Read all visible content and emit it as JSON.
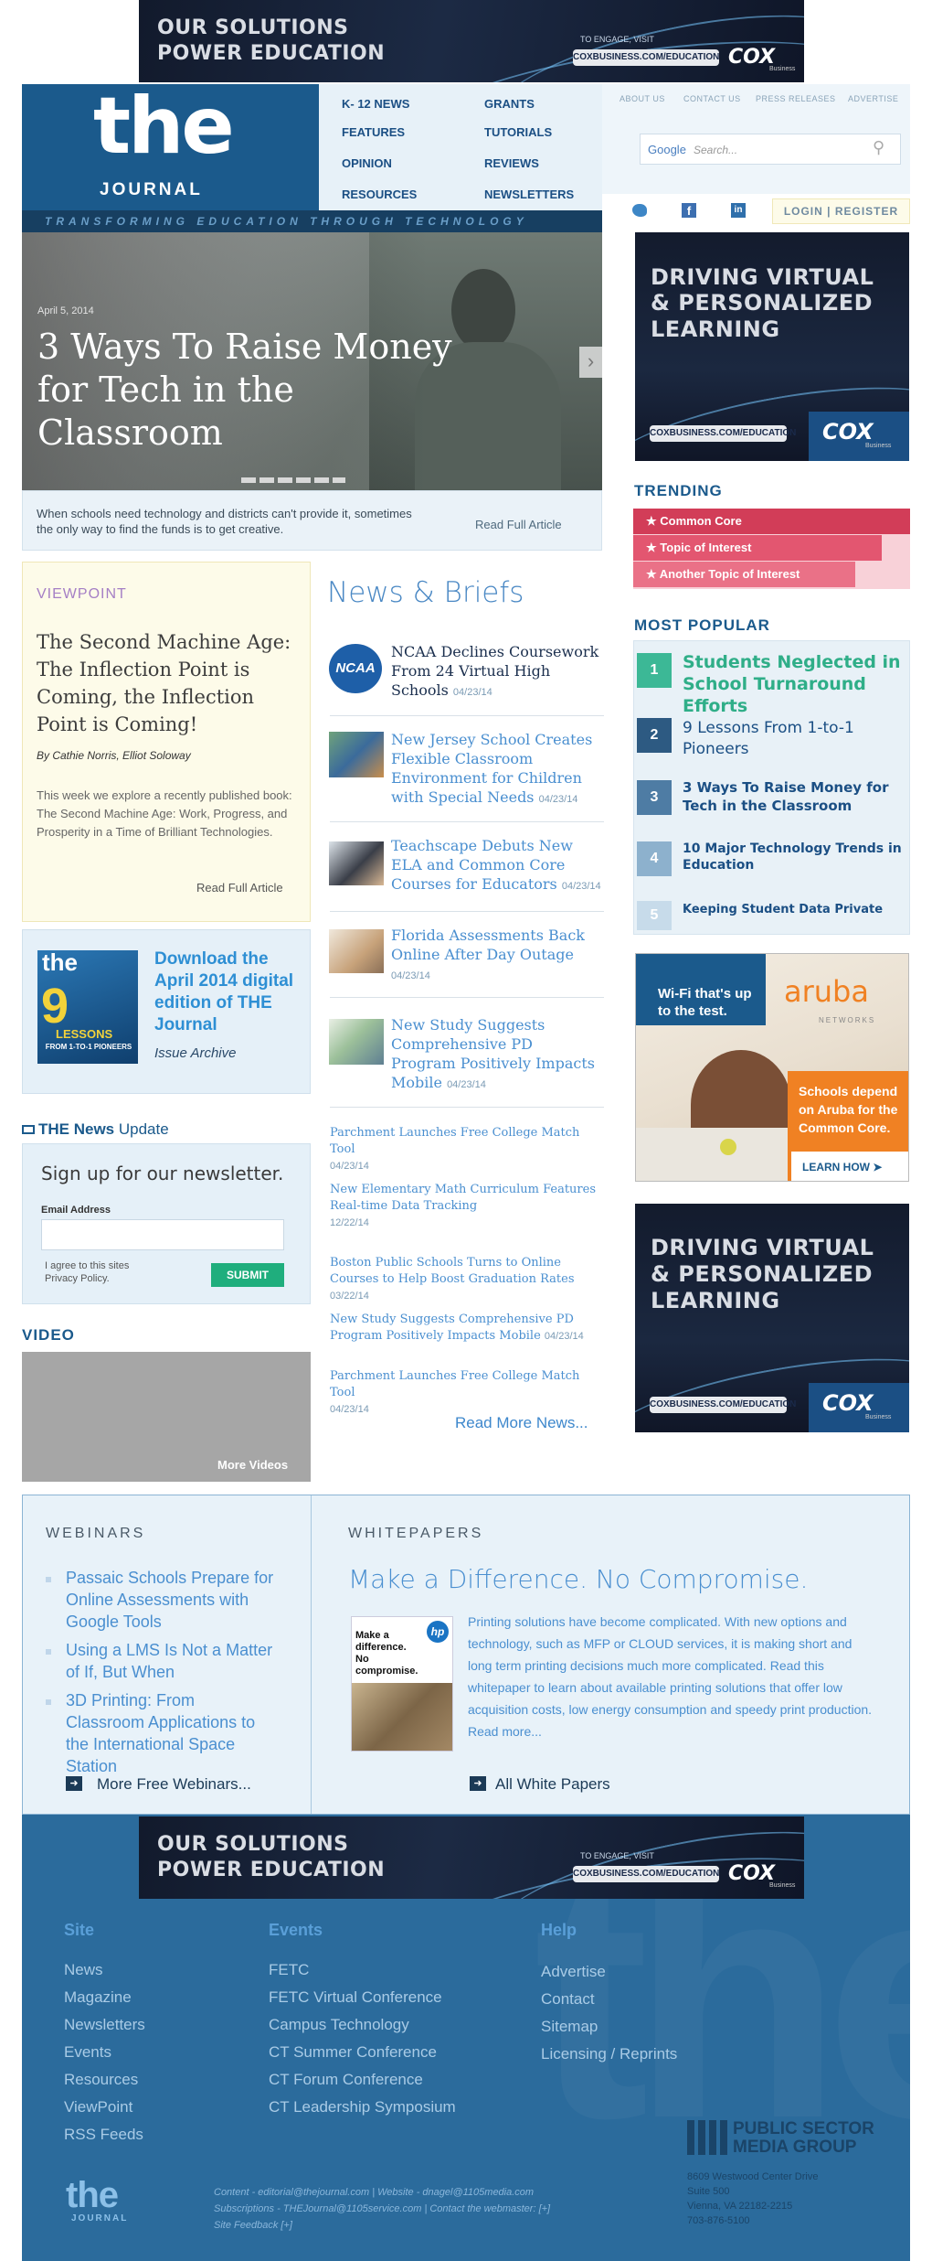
{
  "ad_top": {
    "line1": "OUR SOLUTIONS",
    "line2": "POWER EDUCATION",
    "visit": "TO ENGAGE, VISIT",
    "url": "COXBUSINESS.COM/EDUCATION",
    "brand": "COX",
    "brand_sub": "Business"
  },
  "header": {
    "logo_the": "the",
    "logo_journal": "JOURNAL",
    "tagline": "TRANSFORMING EDUCATION THROUGH TECHNOLOGY",
    "nav": [
      "K- 12 NEWS",
      "GRANTS",
      "FEATURES",
      "TUTORIALS",
      "OPINION",
      "REVIEWS",
      "RESOURCES",
      "NEWSLETTERS"
    ],
    "util": [
      "ABOUT US",
      "CONTACT US",
      "PRESS RELEASES",
      "ADVERTISE"
    ],
    "search_brand": "Google",
    "search_placeholder": "Search...",
    "login": "LOGIN | REGISTER"
  },
  "hero": {
    "date": "April 5, 2014",
    "title": "3 Ways To Raise Money for Tech in the Classroom",
    "caption": "When schools need technology and districts can't provide it, sometimes the only way to find the funds is to get creative.",
    "read_more": "Read Full Article"
  },
  "viewpoint": {
    "label": "VIEWPOINT",
    "title": "The Second Machine Age: The Inflection Point is Coming, the Inflection Point is Coming!",
    "authors": "By Cathie Norris, Elliot Soloway",
    "body": "This week we explore a recently published book: The Second Machine Age: Work, Progress, and Prosperity in a Time of Brilliant Technologies.",
    "read_more": "Read Full Article"
  },
  "digital": {
    "cover_the": "the",
    "cover_num": "9",
    "cover_lessons": "LESSONS",
    "cover_sub": "FROM 1-TO-1 PIONEERS",
    "title": "Download the April 2014 digital edition of THE Journal",
    "archive": "Issue Archive"
  },
  "newsletter": {
    "heading_bold": "THE News",
    "heading_rest": "Update",
    "signup": "Sign up for our newsletter.",
    "email_label": "Email Address",
    "email_placeholder": "",
    "agree": "I agree to this sites Privacy Policy.",
    "submit": "SUBMIT"
  },
  "video": {
    "label": "VIDEO",
    "more": "More Videos"
  },
  "news": {
    "heading": "News & Briefs",
    "ncaa": "NCAA",
    "items": [
      {
        "title": "NCAA Declines Coursework From 24 Virtual High Schools",
        "date": "04/23/14"
      },
      {
        "title": "New Jersey School Creates Flexible Classroom Environment for Children with Special Needs",
        "date": "04/23/14"
      },
      {
        "title": "Teachscape Debuts New ELA and Common Core Courses for Educators",
        "date": "04/23/14"
      },
      {
        "title": "Florida Assessments Back Online After Day Outage",
        "date": "04/23/14"
      },
      {
        "title": "New Study Suggests Comprehensive PD Program Positively Impacts Mobile",
        "date": "04/23/14"
      }
    ],
    "small": [
      {
        "title": "Parchment Launches Free College Match Tool",
        "date": "04/23/14"
      },
      {
        "title": "New Elementary Math Curriculum Features Real-time Data Tracking",
        "date": "12/22/14"
      },
      {
        "title": "Boston Public Schools Turns to Online Courses to Help Boost Graduation Rates",
        "date": "03/22/14"
      },
      {
        "title": "New Study Suggests Comprehensive PD Program Positively Impacts Mobile",
        "date": "04/23/14"
      },
      {
        "title": "Parchment Launches Free College Match Tool",
        "date": "04/23/14"
      }
    ],
    "read_more": "Read More News..."
  },
  "side_ad": {
    "line1": "DRIVING VIRTUAL",
    "line2": "& PERSONALIZED",
    "line3": "LEARNING",
    "url": "COXBUSINESS.COM/EDUCATION",
    "brand": "COX",
    "brand_sub": "Business"
  },
  "trending": {
    "heading": "TRENDING",
    "items": [
      "Common Core",
      "Topic of Interest",
      "Another Topic of Interest"
    ]
  },
  "popular": {
    "heading": "MOST POPULAR",
    "items": [
      {
        "num": "1",
        "title": "Students Neglected in School Turnaround Efforts"
      },
      {
        "num": "2",
        "title": "9 Lessons From 1-to-1 Pioneers"
      },
      {
        "num": "3",
        "title": "3 Ways To Raise Money for Tech in the Classroom"
      },
      {
        "num": "4",
        "title": "10 Major Technology Trends in Education"
      },
      {
        "num": "5",
        "title": "Keeping Student Data Private"
      }
    ]
  },
  "aruba": {
    "headline": "Wi-Fi that's up to the test.",
    "brand": "aruba",
    "brand_sub": "NETWORKS",
    "body": "Schools depend on Aruba for the Common Core.",
    "cta": "LEARN HOW"
  },
  "webinars": {
    "heading": "WEBINARS",
    "items": [
      "Passaic Schools Prepare for Online Assessments with Google Tools",
      "Using a LMS Is Not a Matter of If, But When",
      "3D Printing: From Classroom Applications to the International Space Station"
    ],
    "more": "More Free Webinars..."
  },
  "whitepapers": {
    "heading": "WHITEPAPERS",
    "title": "Make a Difference. No Compromise.",
    "thumb_text": "Make a difference. No compromise.",
    "thumb_brand": "hp",
    "body": "Printing solutions have become complicated. With new options and technology, such as MFP or CLOUD services, it is making short and long term printing decisions much more complicated. Read this whitepaper to learn about available printing solutions that offer low acquisition costs, low energy consumption and speedy print production.",
    "read_more": "Read more...",
    "all": "All White Papers"
  },
  "footer": {
    "site": {
      "heading": "Site",
      "links": [
        "News",
        "Magazine",
        "Newsletters",
        "Events",
        "Resources",
        "ViewPoint",
        "RSS Feeds"
      ]
    },
    "events": {
      "heading": "Events",
      "links": [
        "FETC",
        "FETC Virtual Conference",
        "Campus Technology",
        "CT Summer Conference",
        "CT Forum Conference",
        "CT Leadership Symposium"
      ]
    },
    "help": {
      "heading": "Help",
      "links": [
        "Advertise",
        "Contact",
        "Sitemap",
        "Licensing / Reprints"
      ]
    },
    "contact_line1": "Content - editorial@thejournal.com  |  Website - dnagel@1105media.com",
    "contact_line2": "Subscriptions - THEJournal@1105service.com  |  Contact the webmaster: [+]",
    "contact_line3": "Site Feedback [+]",
    "logo_the": "the",
    "logo_journal": "JOURNAL",
    "psmg_line1": "PUBLIC SECTOR",
    "psmg_line2": "MEDIA GROUP",
    "addr1": "8609 Westwood Center Drive",
    "addr2": "Suite 500",
    "addr3": "Vienna, VA 22182-2215",
    "addr4": "703-876-5100"
  }
}
